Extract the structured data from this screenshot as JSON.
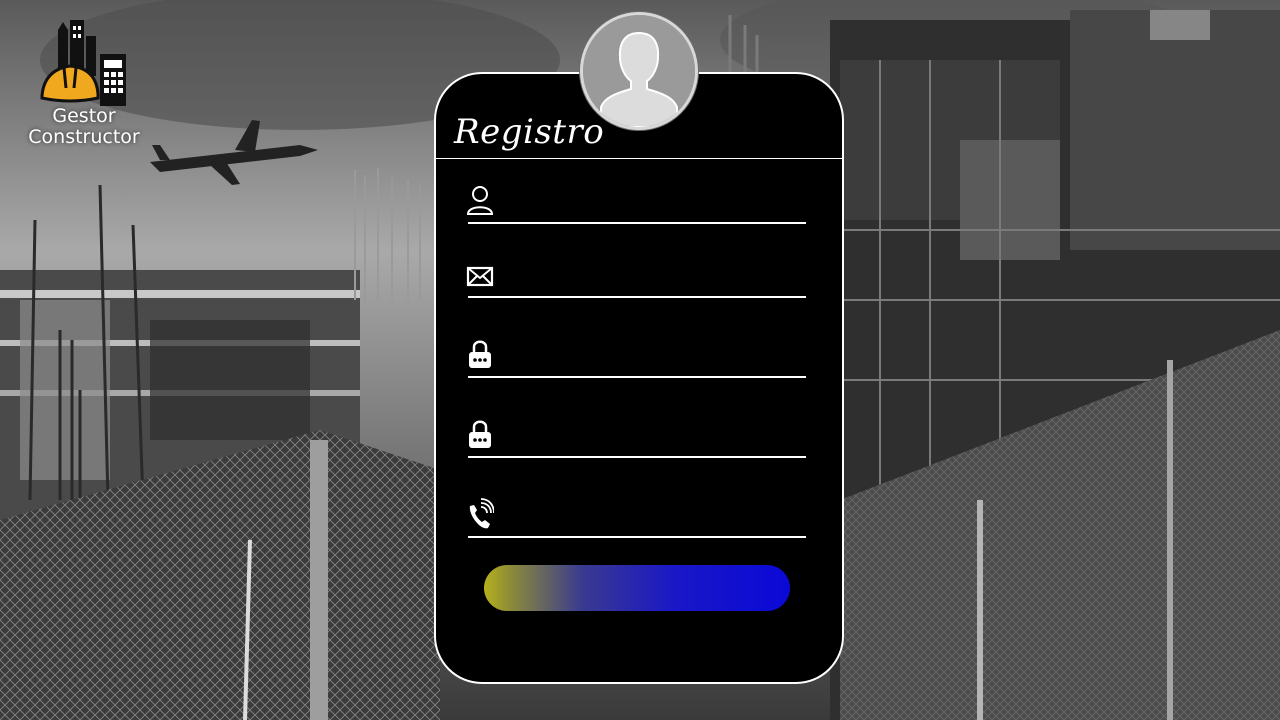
{
  "brand": {
    "line1": "Gestor",
    "line2": "Constructor",
    "accent_color": "#f0a91e"
  },
  "form": {
    "title": "Registro",
    "fields": [
      {
        "icon": "user-icon",
        "placeholder": "",
        "value": ""
      },
      {
        "icon": "mail-icon",
        "placeholder": "",
        "value": ""
      },
      {
        "icon": "lock-icon",
        "placeholder": "",
        "value": ""
      },
      {
        "icon": "lock-icon",
        "placeholder": "",
        "value": ""
      },
      {
        "icon": "phone-icon",
        "placeholder": "",
        "value": ""
      }
    ],
    "submit_label": "",
    "button_gradient": [
      "#b6b01c",
      "#1a18c6",
      "#0a08d6"
    ]
  }
}
